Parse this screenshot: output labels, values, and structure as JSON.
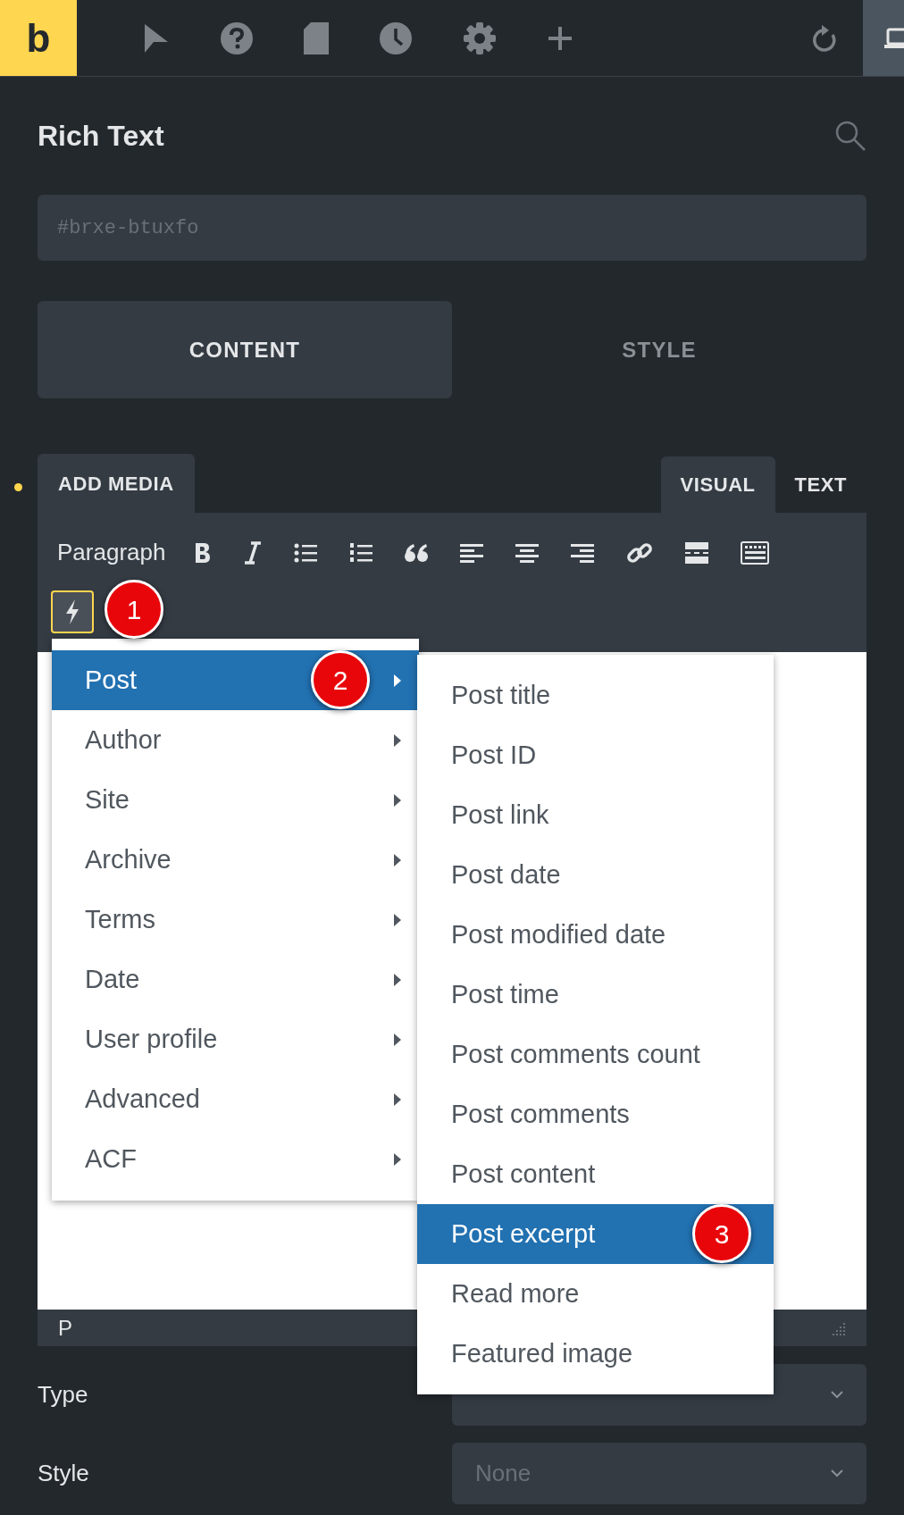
{
  "topbar": {
    "logo": "b"
  },
  "panel": {
    "title": "Rich Text",
    "id_field": {
      "placeholder": "#brxe-btuxfo"
    }
  },
  "tabs": [
    {
      "label": "CONTENT",
      "selected": true
    },
    {
      "label": "STYLE",
      "selected": false
    }
  ],
  "editor": {
    "add_media": "ADD MEDIA",
    "modes": [
      {
        "label": "VISUAL",
        "selected": true
      },
      {
        "label": "TEXT",
        "selected": false
      }
    ],
    "format": "Paragraph",
    "dynamic_data_badge": "1",
    "status_path": "P"
  },
  "menu": {
    "items": [
      {
        "label": "Post",
        "selected": true,
        "badge": "2"
      },
      {
        "label": "Author",
        "selected": false
      },
      {
        "label": "Site",
        "selected": false
      },
      {
        "label": "Archive",
        "selected": false
      },
      {
        "label": "Terms",
        "selected": false
      },
      {
        "label": "Date",
        "selected": false
      },
      {
        "label": "User profile",
        "selected": false
      },
      {
        "label": "Advanced",
        "selected": false
      },
      {
        "label": "ACF",
        "selected": false
      }
    ]
  },
  "submenu": {
    "items": [
      {
        "label": "Post title",
        "selected": false
      },
      {
        "label": "Post ID",
        "selected": false
      },
      {
        "label": "Post link",
        "selected": false
      },
      {
        "label": "Post date",
        "selected": false
      },
      {
        "label": "Post modified date",
        "selected": false
      },
      {
        "label": "Post time",
        "selected": false
      },
      {
        "label": "Post comments count",
        "selected": false
      },
      {
        "label": "Post comments",
        "selected": false
      },
      {
        "label": "Post content",
        "selected": false
      },
      {
        "label": "Post excerpt",
        "selected": true,
        "badge": "3"
      },
      {
        "label": "Read more",
        "selected": false
      },
      {
        "label": "Featured image",
        "selected": false
      }
    ]
  },
  "fields": [
    {
      "label": "Type"
    },
    {
      "label": "Style",
      "value": "None"
    }
  ]
}
